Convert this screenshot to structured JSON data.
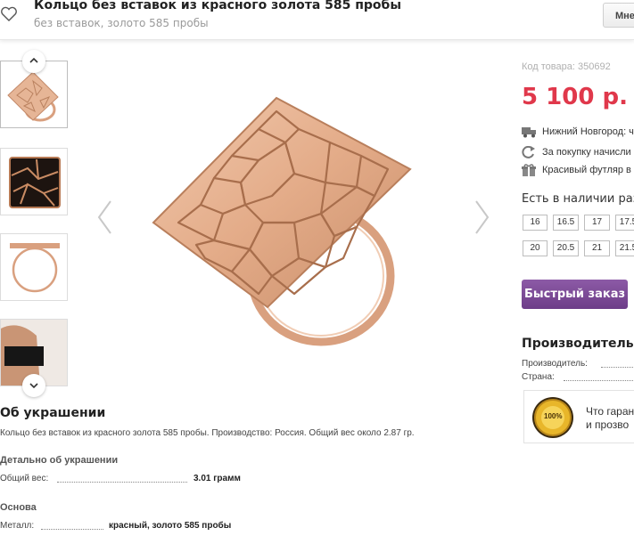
{
  "header": {
    "title": "Кольцо без вставок из красного золота 585 пробы",
    "subtitle": "без вставок, золото 585 пробы",
    "action_label": "Мне"
  },
  "product": {
    "sku_label": "Код товара: 350692",
    "price": "5 100 р.",
    "info": [
      {
        "icon": "truck-icon",
        "text": "Нижний Новгород: ч"
      },
      {
        "icon": "refresh-icon",
        "text": "За покупку начисли"
      },
      {
        "icon": "gift-icon",
        "text": "Красивый футляр в"
      }
    ],
    "availability_title": "Есть в наличии раз",
    "sizes": [
      "16",
      "16.5",
      "17",
      "17.5",
      "20",
      "20.5",
      "21",
      "21.5"
    ],
    "quick_order_label": "Быстрый заказ",
    "maker_title": "Производитель и",
    "maker_rows": [
      {
        "label": "Производитель:"
      },
      {
        "label": "Страна:"
      }
    ],
    "guarantee": {
      "line1": "Что гаран",
      "line2": "и прозво",
      "seal_text": "100%"
    }
  },
  "description": {
    "about_title": "Об украшении",
    "about_text": "Кольцо без вставок из красного золота 585 пробы. Производство: Россия. Общий вес около 2.87 гр.",
    "details_title": "Детально об украшении",
    "weight_label": "Общий вес:",
    "weight_value": "3.01 грамм",
    "basis_title": "Основа",
    "metal_label": "Металл:",
    "metal_value": "красный, золото 585 пробы"
  },
  "colors": {
    "price": "#e0384b",
    "button": "#7a4796",
    "gold": "#e3b08f"
  }
}
